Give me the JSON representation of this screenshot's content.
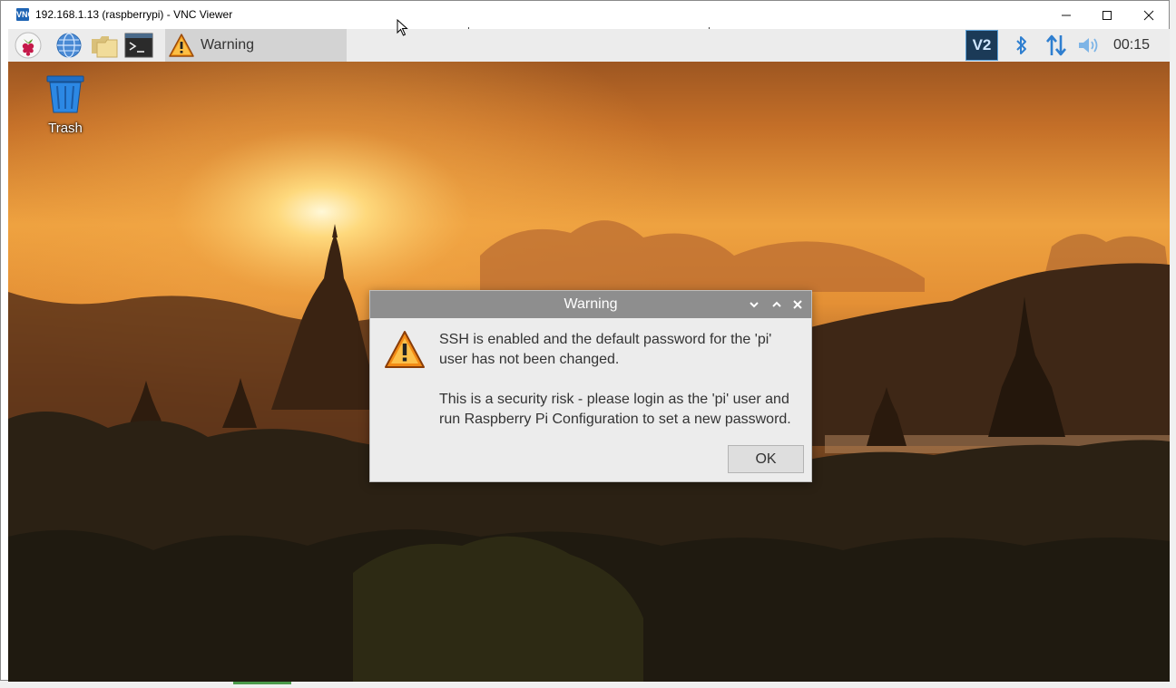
{
  "window": {
    "app_icon": "VNC",
    "title": "192.168.1.13 (raspberrypi) - VNC Viewer",
    "controls": [
      "minimize-icon",
      "maximize-icon",
      "close-icon"
    ]
  },
  "remote": {
    "panel": {
      "launchers": [
        "raspberry-menu-icon",
        "web-browser-icon",
        "file-manager-icon",
        "terminal-icon"
      ],
      "task": {
        "icon": "warning-icon",
        "label": "Warning"
      },
      "tray": {
        "vnc_label": "V2",
        "icons": [
          "vnc-server-icon",
          "bluetooth-icon",
          "network-icon",
          "volume-icon"
        ],
        "clock": "00:15"
      }
    },
    "desktop": {
      "icons": [
        {
          "label": "Trash",
          "icon": "trash-icon"
        }
      ]
    },
    "dialog": {
      "title": "Warning",
      "controls": [
        "minimize-icon",
        "maximize-icon",
        "close-icon"
      ],
      "icon": "warning-icon",
      "message_line1": "SSH is enabled and the default password for the 'pi' user has not been changed.",
      "message_line2": "This is a security risk - please login as the 'pi' user and run Raspberry Pi Configuration to set a new password.",
      "ok_label": "OK"
    }
  },
  "colors": {
    "panel_bg": "#ececec",
    "dialog_title_bg": "#8e8e8e",
    "vnc_blue": "#1e64b4",
    "sunset_orange": "#f0a040"
  }
}
